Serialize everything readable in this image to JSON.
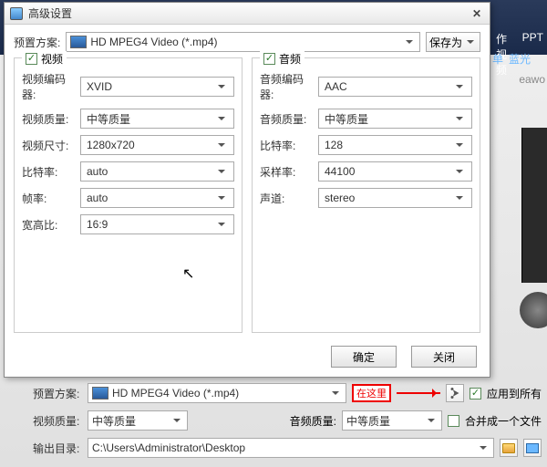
{
  "bg": {
    "tab_make_video": "作视频",
    "tab_ppt": "PPT",
    "subtab_single": "单",
    "subtab_bluray": "蓝光",
    "brand_fragment": "eawo"
  },
  "dialog": {
    "title": "高级设置",
    "preset_label": "预置方案:",
    "preset_value": "HD MPEG4 Video (*.mp4)",
    "save_as": "保存为",
    "ok": "确定",
    "close": "关闭"
  },
  "video": {
    "section": "视频",
    "codec_label": "视频编码器:",
    "codec": "XVID",
    "quality_label": "视频质量:",
    "quality": "中等质量",
    "size_label": "视频尺寸:",
    "size": "1280x720",
    "bitrate_label": "比特率:",
    "bitrate": "auto",
    "framerate_label": "帧率:",
    "framerate": "auto",
    "aspect_label": "宽高比:",
    "aspect": "16:9"
  },
  "audio": {
    "section": "音频",
    "codec_label": "音频编码器:",
    "codec": "AAC",
    "quality_label": "音频质量:",
    "quality": "中等质量",
    "bitrate_label": "比特率:",
    "bitrate": "128",
    "samplerate_label": "采样率:",
    "samplerate": "44100",
    "channel_label": "声道:",
    "channel": "stereo"
  },
  "lower": {
    "preset_label": "预置方案:",
    "preset_value": "HD MPEG4 Video (*.mp4)",
    "callout": "在这里",
    "apply_all": "应用到所有",
    "video_quality_label": "视频质量:",
    "video_quality": "中等质量",
    "audio_quality_label": "音频质量:",
    "audio_quality": "中等质量",
    "merge_one": "合并成一个文件",
    "output_label": "输出目录:",
    "output_path": "C:\\Users\\Administrator\\Desktop"
  }
}
